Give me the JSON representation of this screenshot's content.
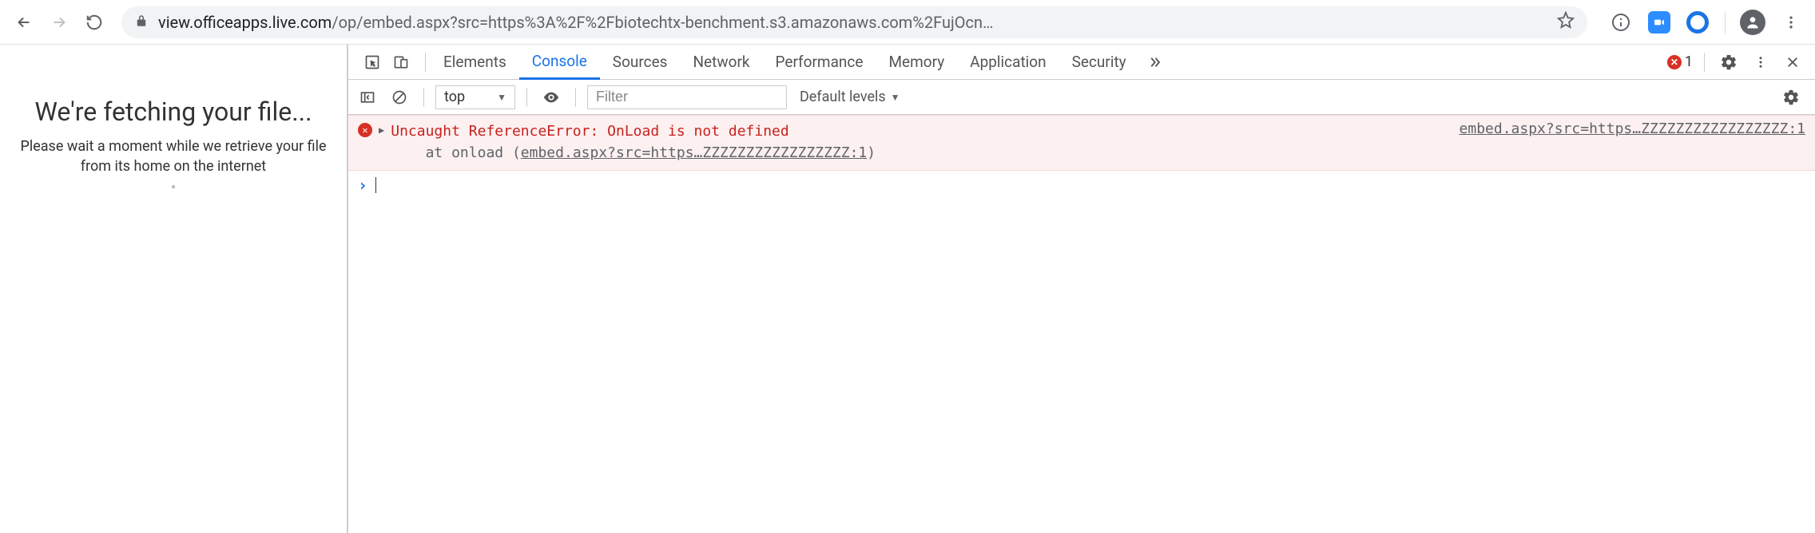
{
  "browser": {
    "url_host": "view.officeapps.live.com",
    "url_path": "/op/embed.aspx?src=https%3A%2F%2Fbiotechtx-benchment.s3.amazonaws.com%2FujOcn…"
  },
  "page": {
    "title": "We're fetching your file...",
    "subtitle": "Please wait a moment while we retrieve your file from its home on the internet"
  },
  "devtools": {
    "tabs": {
      "elements": "Elements",
      "console": "Console",
      "sources": "Sources",
      "network": "Network",
      "performance": "Performance",
      "memory": "Memory",
      "application": "Application",
      "security": "Security"
    },
    "error_count": "1",
    "toolbar": {
      "context": "top",
      "filter_placeholder": "Filter",
      "levels": "Default levels"
    },
    "console": {
      "error_message": "Uncaught ReferenceError: OnLoad is not defined",
      "stack_prefix": "    at onload (",
      "stack_link": "embed.aspx?src=https…ZZZZZZZZZZZZZZZZZ:1",
      "stack_suffix": ")",
      "source_link": "embed.aspx?src=https…ZZZZZZZZZZZZZZZZZ:1"
    }
  }
}
